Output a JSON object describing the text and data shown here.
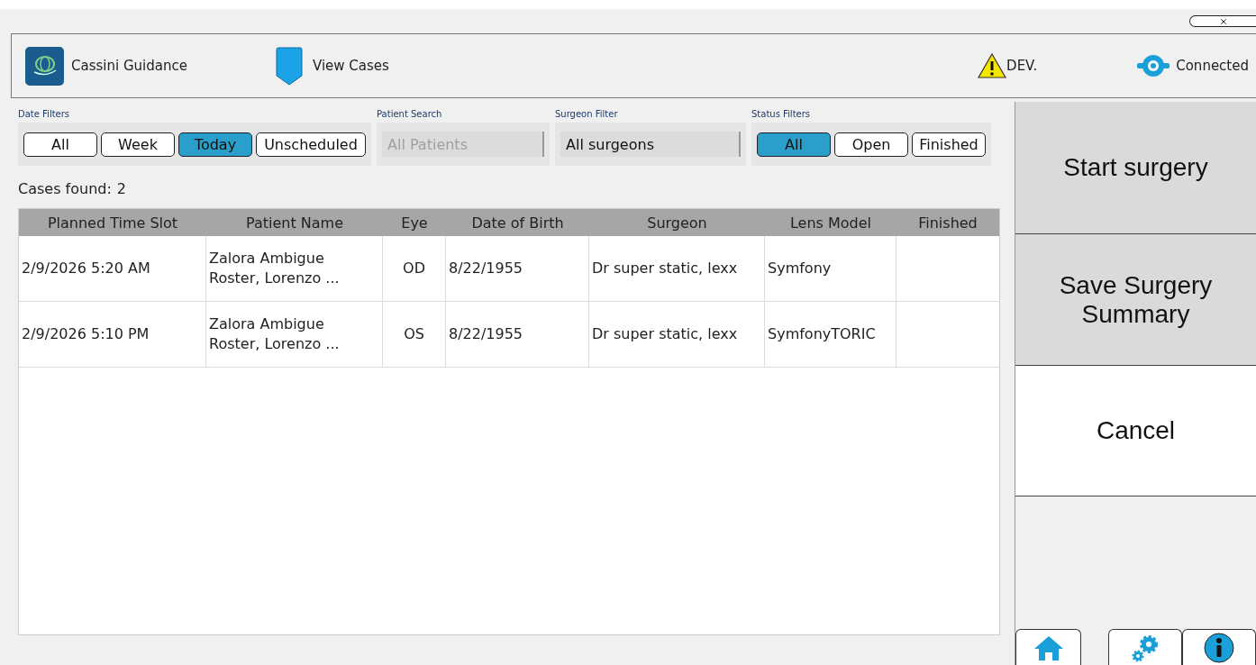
{
  "header": {
    "app_name": "Cassini Guidance",
    "view_label": "View Cases",
    "environment": "DEV.",
    "connection": "Connected"
  },
  "filters": {
    "date": {
      "label": "Date Filters",
      "options": [
        {
          "label": "All",
          "selected": false
        },
        {
          "label": "Week",
          "selected": false
        },
        {
          "label": "Today",
          "selected": true
        },
        {
          "label": "Unscheduled",
          "selected": false
        }
      ]
    },
    "patient_search": {
      "label": "Patient Search",
      "value": "All Patients",
      "disabled": true
    },
    "surgeon": {
      "label": "Surgeon Filter",
      "value": "All surgeons",
      "disabled": false
    },
    "status": {
      "label": "Status Filters",
      "options": [
        {
          "label": "All",
          "selected": true
        },
        {
          "label": "Open",
          "selected": false
        },
        {
          "label": "Finished",
          "selected": false
        }
      ]
    }
  },
  "cases_found": {
    "label": "Cases found:",
    "count": "2"
  },
  "table": {
    "columns": [
      "Planned Time Slot",
      "Patient Name",
      "Eye",
      "Date of Birth",
      "Surgeon",
      "Lens Model",
      "Finished"
    ],
    "rows": [
      {
        "cells": [
          "2/9/2026 5:20 AM",
          "Zalora Ambigue\nRoster, Lorenzo ...",
          "OD",
          "8/22/1955",
          "Dr super static, lexx",
          "Symfony",
          ""
        ]
      },
      {
        "cells": [
          "2/9/2026 5:10 PM",
          "Zalora Ambigue\nRoster, Lorenzo ...",
          "OS",
          "8/22/1955",
          "Dr super static, lexx",
          "SymfonyTORIC",
          ""
        ]
      }
    ]
  },
  "actions": [
    {
      "label": "Start surgery",
      "kind": "grey"
    },
    {
      "label": "Save Surgery Summary",
      "kind": "grey"
    },
    {
      "label": "Cancel",
      "kind": "white"
    }
  ]
}
